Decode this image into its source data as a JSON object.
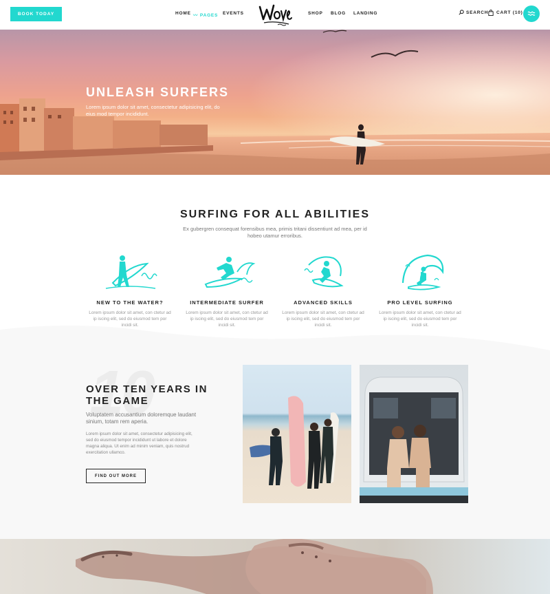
{
  "header": {
    "book_label": "BOOK TODAY",
    "nav": {
      "home": "HOME",
      "pages": "PAGES",
      "events": "EVENTS",
      "shop": "SHOP",
      "blog": "BLOG",
      "landing": "LANDING"
    },
    "search_label": "SEARCH",
    "cart_label": "CART (10)",
    "accent_color": "#22d8cf"
  },
  "hero": {
    "title": "UNLEASH SURFERS",
    "subtitle": "Lorem ipsum dolor sit amet, consectetur adipisicing elit, do eius mod tempor incididunt."
  },
  "abilities": {
    "title": "SURFING FOR ALL ABILITIES",
    "subtitle": "Ex gubergren consequat forensibus mea, primis tritani dissentiunt ad mea, per id hobeo utamur erroribus.",
    "cards": [
      {
        "title": "NEW TO THE WATER?",
        "text": "Lorem ipsum dolor sit amet, con ctetur ad ip iscing elit, sed do eiusmod tem por incidi sit."
      },
      {
        "title": "INTERMEDIATE SURFER",
        "text": "Lorem ipsum dolor sit amet, con ctetur ad ip iscing elit, sed do eiusmod tem por incidi sit."
      },
      {
        "title": "ADVANCED SKILLS",
        "text": "Lorem ipsum dolor sit amet, con ctetur ad ip iscing elit, sed do eiusmod tem por incidi sit."
      },
      {
        "title": "PRO LEVEL SURFING",
        "text": "Lorem ipsum dolor sit amet, con ctetur ad ip iscing elit, sed do eiusmod tem por incidi sit."
      }
    ]
  },
  "years": {
    "big_number": "10",
    "title": "OVER TEN YEARS IN THE GAME",
    "subtitle": "Voluptatem accusantium doloremque laudant sinium, totam rem aperia.",
    "text": "Lorem ipsum dolor sit amet, consectetur adipisicing elit, sed do eiusmod tempor incididunt ut labore et dolore magna aliqua. Ut enim ad minim veniam, quis nostrud exercitation ullamco.",
    "button_label": "FIND OUT MORE"
  }
}
